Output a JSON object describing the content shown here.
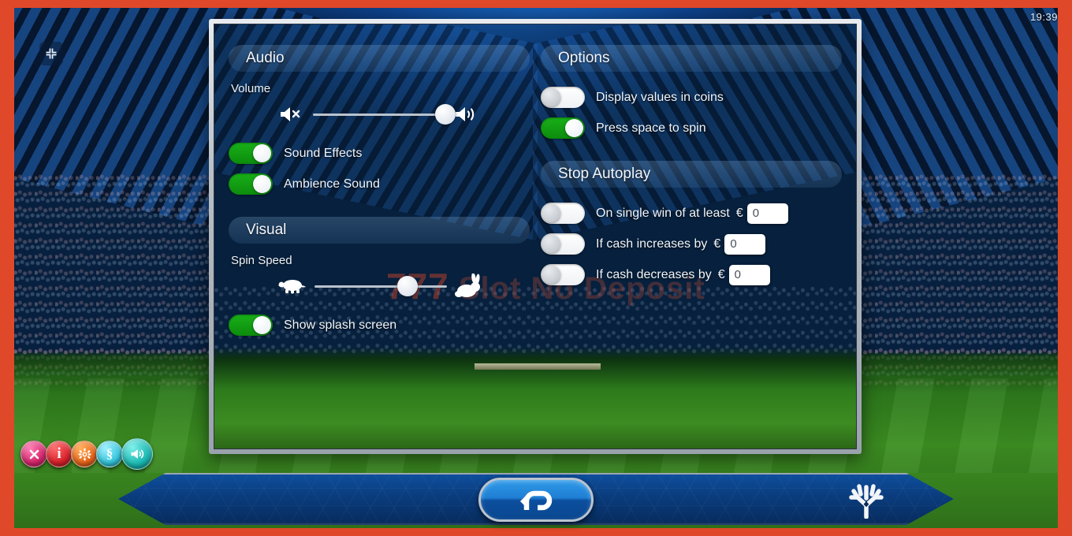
{
  "window": {
    "clock": "19:39",
    "accent_orange": "#e0482a",
    "toggle_on_color": "#12a012",
    "panel_border_color": "#c3c9d0"
  },
  "topbar": {
    "fullscreen_icon": "exit-fullscreen-icon"
  },
  "watermark": {
    "sevens": "777",
    "text": "Slot No Deposit"
  },
  "settings": {
    "audio": {
      "header": "Audio",
      "volume_label": "Volume",
      "volume_value": 100,
      "mute_icon": "speaker-mute-icon",
      "max_icon": "speaker-loud-icon",
      "toggles": [
        {
          "label": "Sound Effects",
          "state": "on"
        },
        {
          "label": "Ambience Sound",
          "state": "on"
        }
      ]
    },
    "visual": {
      "header": "Visual",
      "spin_speed_label": "Spin Speed",
      "spin_speed_value": 70,
      "slow_icon": "turtle-icon",
      "fast_icon": "rabbit-icon",
      "toggles": [
        {
          "label": "Show splash screen",
          "state": "on"
        }
      ]
    },
    "options": {
      "header": "Options",
      "toggles": [
        {
          "label": "Display values in coins",
          "state": "off"
        },
        {
          "label": "Press space to spin",
          "state": "on"
        }
      ]
    },
    "stop_autoplay": {
      "header": "Stop Autoplay",
      "rows": [
        {
          "label": "On single win of at least",
          "currency": "€",
          "value": "0",
          "state": "off"
        },
        {
          "label": "If cash increases by",
          "currency": "€",
          "value": "0",
          "state": "off"
        },
        {
          "label": "If cash decreases by",
          "currency": "€",
          "value": "0",
          "state": "off"
        }
      ]
    }
  },
  "quickbar": {
    "buttons": [
      {
        "name": "close-button",
        "glyph": "✕",
        "color": "#d6246b"
      },
      {
        "name": "info-button",
        "glyph": "i",
        "color": "#d8202a"
      },
      {
        "name": "settings-button",
        "glyph": "⚙",
        "color": "#e8651a"
      },
      {
        "name": "paytable-button",
        "glyph": "§",
        "color": "#34c6dd"
      },
      {
        "name": "sound-button",
        "glyph": "◀",
        "color": "#19b6b0"
      }
    ]
  },
  "bottombar": {
    "back_icon": "back-arrow-icon",
    "logo_icon": "yggdrasil-tree-logo-icon"
  }
}
